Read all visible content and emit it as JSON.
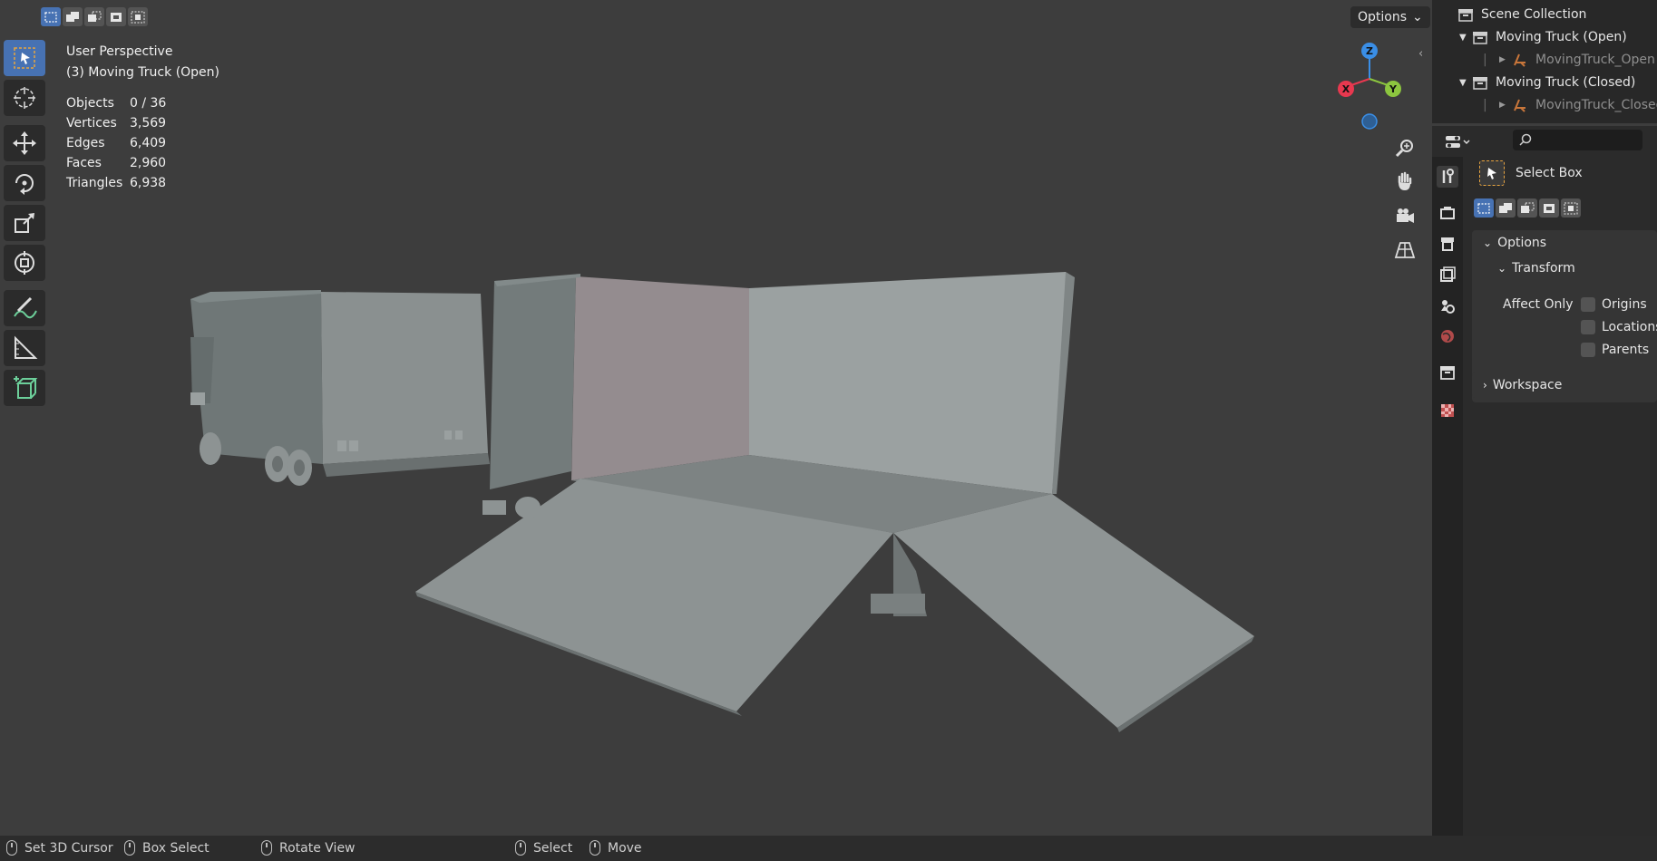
{
  "viewport": {
    "view_name": "User Perspective",
    "active_object": "(3) Moving Truck (Open)",
    "options_label": "Options",
    "stats": [
      {
        "label": "Objects",
        "value": "0 / 36"
      },
      {
        "label": "Vertices",
        "value": "3,569"
      },
      {
        "label": "Edges",
        "value": "6,409"
      },
      {
        "label": "Faces",
        "value": "2,960"
      },
      {
        "label": "Triangles",
        "value": "6,938"
      }
    ],
    "gizmo": {
      "x": "X",
      "y": "Y",
      "z": "Z"
    },
    "selection_modes": [
      "select-new-icon",
      "select-extend-icon",
      "select-subtract-icon",
      "select-invert-icon",
      "select-intersect-icon"
    ],
    "tools": [
      "select-box-icon",
      "cursor-icon",
      "move-icon",
      "rotate-icon",
      "scale-icon",
      "transform-icon",
      "annotate-icon",
      "measure-icon",
      "add-cube-icon"
    ],
    "nav_buttons": [
      "zoom-icon",
      "hand-pan-icon",
      "camera-icon",
      "grid-perspective-icon"
    ]
  },
  "outliner": {
    "root": "Scene Collection",
    "items": [
      {
        "label": "Moving Truck (Open)",
        "type": "collection"
      },
      {
        "label": "MovingTruck_Open",
        "type": "object"
      },
      {
        "label": "Moving Truck (Closed)",
        "type": "collection"
      },
      {
        "label": "MovingTruck_Closed",
        "type": "object"
      }
    ]
  },
  "properties": {
    "tool_name": "Select Box",
    "options_panel": "Options",
    "transform_panel": "Transform",
    "affect_only_label": "Affect Only",
    "checkboxes": [
      "Origins",
      "Locations",
      "Parents"
    ],
    "workspace_panel": "Workspace"
  },
  "statusbar": {
    "items": [
      "Set 3D Cursor",
      "Box Select",
      "Rotate View",
      "Select",
      "Move"
    ]
  },
  "colors": {
    "accent": "#4772b3",
    "axis_x": "#e8384f",
    "axis_y": "#8cc63f",
    "axis_z": "#3a8ee6",
    "viewport_bg": "#3d3d3d"
  }
}
